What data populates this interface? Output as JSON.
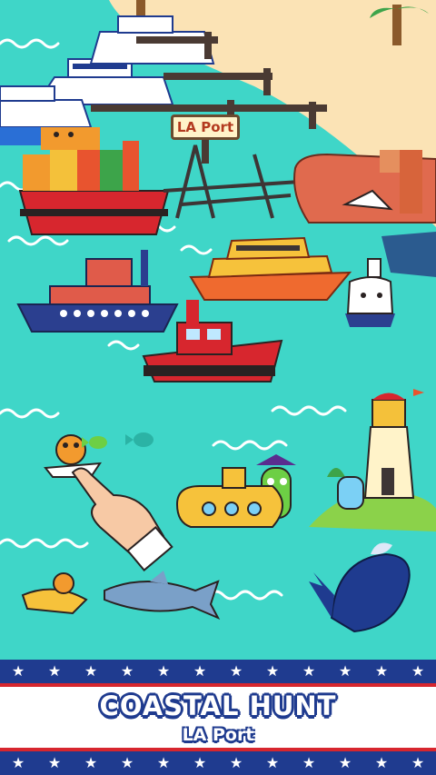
{
  "scene": {
    "port_sign": "LA Port",
    "colors": {
      "water": "#3fd6c8",
      "sand": "#fbe3b5",
      "wave": "#ffffff",
      "navy": "#1f3b8f",
      "red": "#d7262e"
    },
    "objects": [
      "yachts",
      "pier",
      "container-ship",
      "port-crane",
      "cargo-ship-red",
      "tugboat-blue",
      "yellow-yacht",
      "white-buoy-boat",
      "red-fishing-boat",
      "lighthouse",
      "cactus-pirate",
      "submarine-yellow",
      "orange-monster-boat",
      "fish-green",
      "fish-teal",
      "shark",
      "whale",
      "jet-ski-dog",
      "tap-hand-icon"
    ]
  },
  "banner": {
    "title": "COASTAL HUNT",
    "subtitle": "LA Port",
    "star_icon": "★"
  }
}
